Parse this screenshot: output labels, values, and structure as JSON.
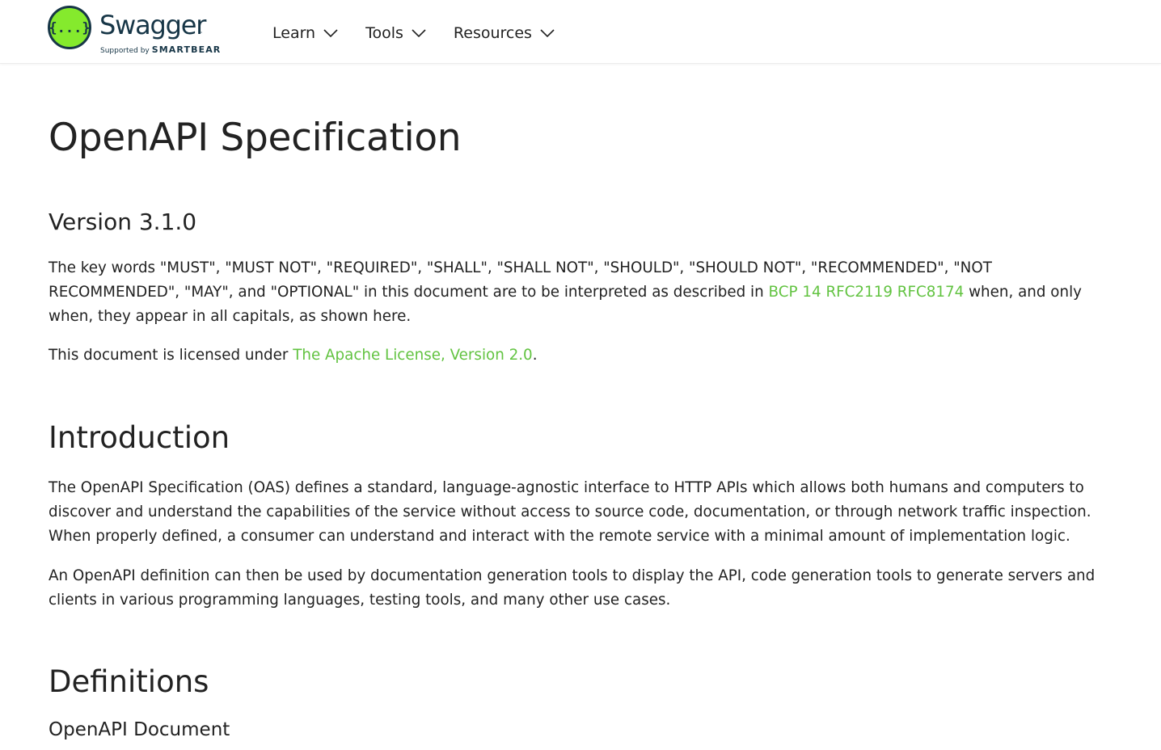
{
  "brand": {
    "name": "Swagger",
    "trademark": "™",
    "supported_by": "Supported by",
    "supporter": "SMARTBEAR",
    "logo_glyph": "{...}",
    "logo_icon": "swagger-logo-icon",
    "logo_color": "#85ea2d",
    "text_color": "#173647"
  },
  "nav": {
    "items": [
      {
        "label": "Learn",
        "icon": "chevron-down-icon"
      },
      {
        "label": "Tools",
        "icon": "chevron-down-icon"
      },
      {
        "label": "Resources",
        "icon": "chevron-down-icon"
      }
    ]
  },
  "page": {
    "title": "OpenAPI Specification",
    "version_heading": "Version 3.1.0",
    "keywords_para": {
      "before": "The key words \"MUST\", \"MUST NOT\", \"REQUIRED\", \"SHALL\", \"SHALL NOT\", \"SHOULD\", \"SHOULD NOT\", \"RECOMMENDED\", \"NOT RECOMMENDED\", \"MAY\", and \"OPTIONAL\" in this document are to be interpreted as described in ",
      "links": [
        "BCP 14",
        "RFC2119",
        "RFC8174"
      ],
      "after": " when, and only when, they appear in all capitals, as shown here."
    },
    "license_para": {
      "before": "This document is licensed under ",
      "link": "The Apache License, Version 2.0",
      "after": "."
    },
    "introduction": {
      "heading": "Introduction",
      "para1": "The OpenAPI Specification (OAS) defines a standard, language-agnostic interface to HTTP APIs which allows both humans and computers to discover and understand the capabilities of the service without access to source code, documentation, or through network traffic inspection. When properly defined, a consumer can understand and interact with the remote service with a minimal amount of implementation logic.",
      "para2": "An OpenAPI definition can then be used by documentation generation tools to display the API, code generation tools to generate servers and clients in various programming languages, testing tools, and many other use cases."
    },
    "definitions": {
      "heading": "Definitions",
      "sub_heading": "OpenAPI Document"
    }
  },
  "colors": {
    "link": "#62c341",
    "text": "#222222",
    "background": "#ffffff"
  }
}
